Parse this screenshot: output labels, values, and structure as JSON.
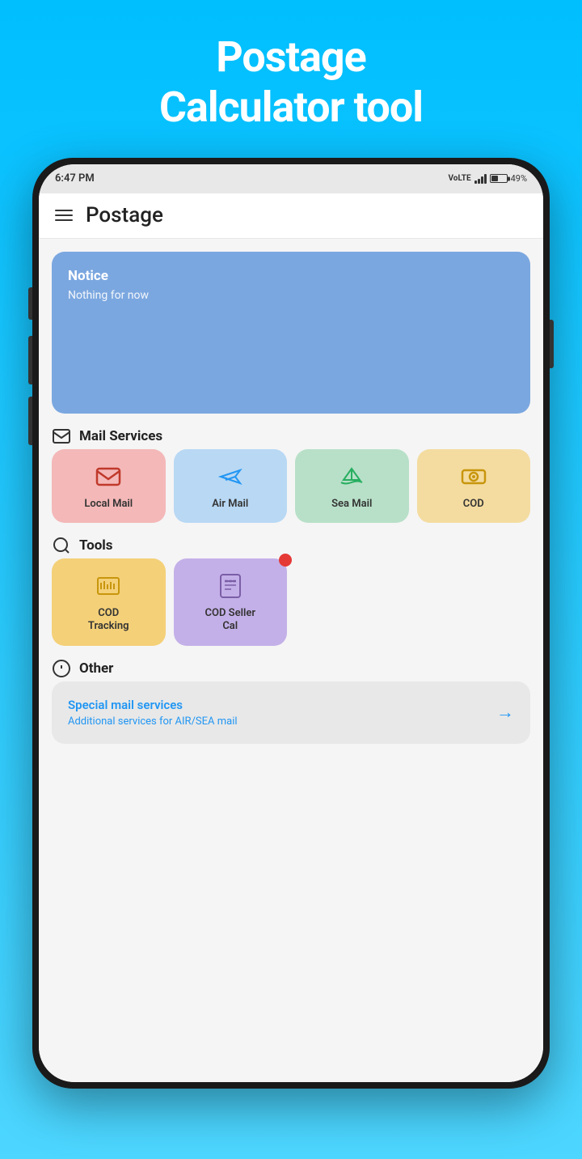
{
  "page": {
    "title_line1": "Postage",
    "title_line2": "Calculator tool"
  },
  "status_bar": {
    "time": "6:47 PM",
    "battery_percent": "49%"
  },
  "app_header": {
    "title": "Postage"
  },
  "notice": {
    "title": "Notice",
    "body": "Nothing for now"
  },
  "mail_services": {
    "section_label": "Mail Services",
    "items": [
      {
        "id": "local-mail",
        "label": "Local Mail",
        "color_class": "local-mail"
      },
      {
        "id": "air-mail",
        "label": "Air Mail",
        "color_class": "air-mail"
      },
      {
        "id": "sea-mail",
        "label": "Sea Mail",
        "color_class": "sea-mail"
      },
      {
        "id": "cod",
        "label": "COD",
        "color_class": "cod"
      }
    ]
  },
  "tools": {
    "section_label": "Tools",
    "items": [
      {
        "id": "cod-tracking",
        "label": "COD Tracking",
        "color_class": "cod-tracking",
        "has_notification": false
      },
      {
        "id": "cod-seller",
        "label": "COD Seller Cal",
        "color_class": "cod-seller",
        "has_notification": true
      }
    ]
  },
  "other": {
    "section_label": "Other",
    "special_mail": {
      "title": "Special mail services",
      "subtitle": "Additional services for AIR/SEA mail"
    }
  }
}
